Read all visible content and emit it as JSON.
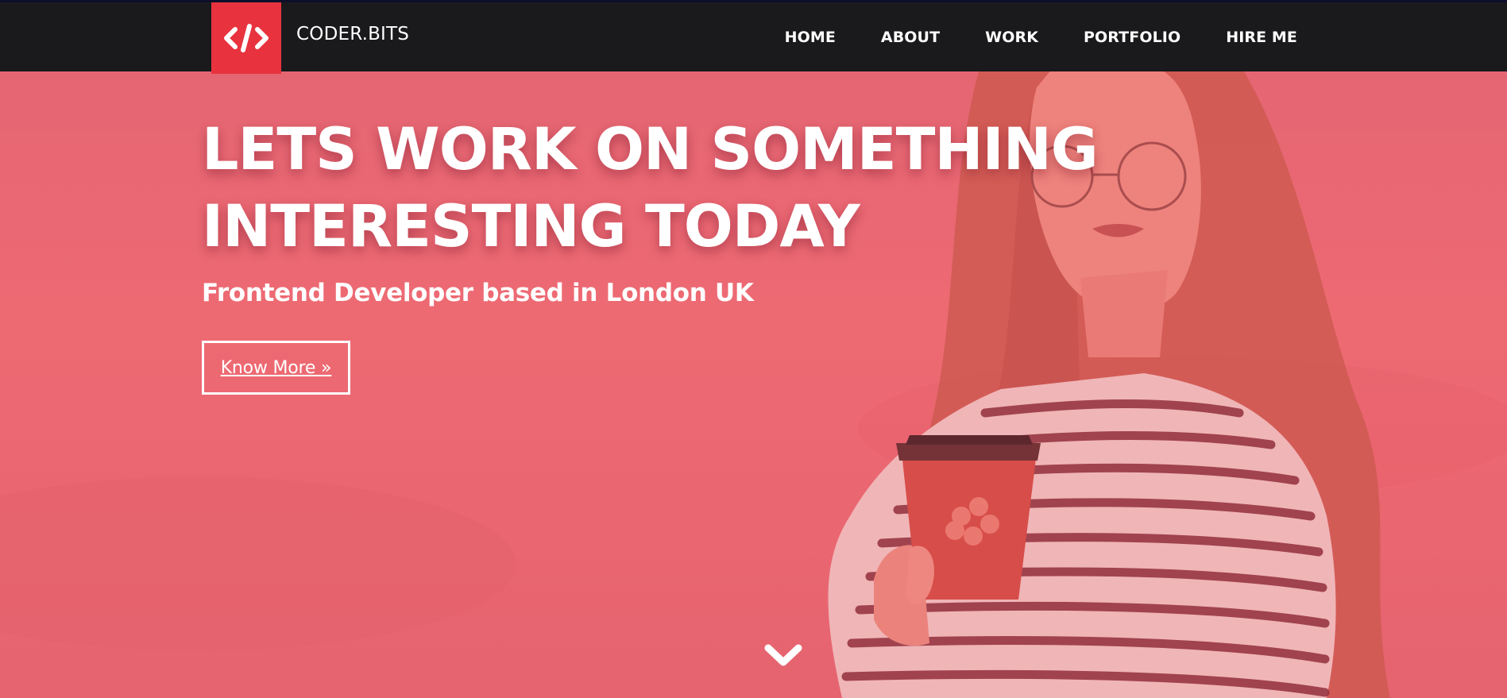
{
  "brand": {
    "name": "CODER.BITS",
    "logo_icon": "code-brackets-icon",
    "accent": "#e8333f"
  },
  "nav": {
    "items": [
      "HOME",
      "ABOUT",
      "WORK",
      "PORTFOLIO",
      "HIRE ME"
    ]
  },
  "hero": {
    "title_line1": "LETS WORK ON SOMETHING",
    "title_line2": "INTERESTING TODAY",
    "subtitle": "Frontend Developer based in London UK",
    "cta_label": "Know More »",
    "scroll_icon": "chevron-down-icon",
    "overlay_color": "#ee6d76"
  }
}
